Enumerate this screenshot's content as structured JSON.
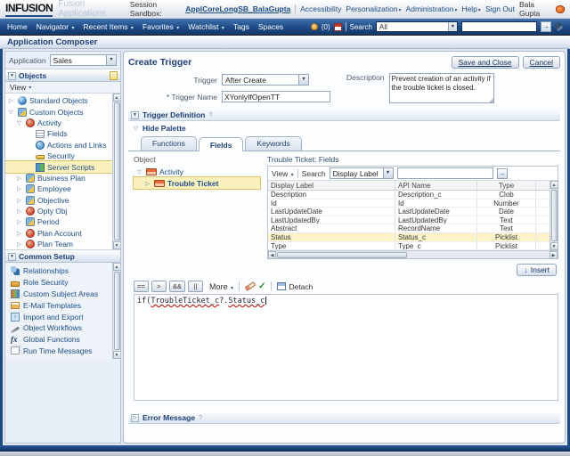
{
  "page_title": "Application Composer",
  "header": {
    "logo": "INFUSION",
    "watermark": "Fusion Applications",
    "session_label": "Session Sandbox:",
    "session_value": "ApplCoreLongSB_BalaGupta",
    "accessibility": "Accessibility",
    "personalization": "Personalization",
    "administration": "Administration",
    "help": "Help",
    "sign_out": "Sign Out",
    "user": "Bala Gupta"
  },
  "navbar": {
    "items": [
      {
        "label": "Home"
      },
      {
        "label": "Navigator"
      },
      {
        "label": "Recent Items"
      },
      {
        "label": "Favorites"
      },
      {
        "label": "Watchlist"
      },
      {
        "label": "Tags"
      },
      {
        "label": "Spaces"
      }
    ],
    "notification_count": "(0)",
    "search_label": "Search",
    "search_scope": "All",
    "search_value": ""
  },
  "sidebar": {
    "application_label": "Application",
    "application_value": "Sales",
    "objects_panel": {
      "title": "Objects",
      "view_menu": "View",
      "tree": [
        {
          "label": "Standard Objects"
        },
        {
          "label": "Custom Objects"
        },
        {
          "label": "Activity"
        },
        {
          "label": "Fields"
        },
        {
          "label": "Actions and Links"
        },
        {
          "label": "Security"
        },
        {
          "label": "Server Scripts"
        },
        {
          "label": "Business Plan"
        },
        {
          "label": "Employee"
        },
        {
          "label": "Objective"
        },
        {
          "label": "Opty Obj"
        },
        {
          "label": "Period"
        },
        {
          "label": "Plan Account"
        },
        {
          "label": "Plan Team"
        }
      ]
    },
    "common_setup": {
      "title": "Common Setup",
      "items": [
        {
          "label": "Relationships"
        },
        {
          "label": "Role Security"
        },
        {
          "label": "Custom Subject Areas"
        },
        {
          "label": "E-Mail Templates"
        },
        {
          "label": "Import and Export"
        },
        {
          "label": "Object Workflows"
        },
        {
          "label": "Global Functions"
        },
        {
          "label": "Run Time Messages"
        }
      ]
    }
  },
  "main": {
    "title": "Create Trigger",
    "save_button": "Save and Close",
    "cancel_button": "Cancel",
    "trigger_label": "Trigger",
    "trigger_value": "After Create",
    "trigger_name_label": "* Trigger Name",
    "trigger_name_value": "XYonlyIfOpenTT",
    "description_label": "Description",
    "description_value": "Prevent creation of an activity if the trouble ticket is closed.",
    "trigger_definition": {
      "title": "Trigger Definition",
      "hide_palette": "Hide Palette",
      "tabs": [
        {
          "label": "Functions"
        },
        {
          "label": "Fields"
        },
        {
          "label": "Keywords"
        }
      ],
      "active_tab": "Fields",
      "object_label": "Object",
      "object_tree": [
        {
          "label": "Activity"
        },
        {
          "label": "Trouble Ticket"
        }
      ],
      "fields_table": {
        "title": "Trouble Ticket: Fields",
        "view_menu": "View",
        "search_label": "Search",
        "search_scope": "Display Label",
        "columns": [
          "Display Label",
          "API Name",
          "Type"
        ],
        "rows": [
          {
            "label": "Description",
            "api": "Description_c",
            "type": "Clob"
          },
          {
            "label": "Id",
            "api": "Id",
            "type": "Number"
          },
          {
            "label": "LastUpdateDate",
            "api": "LastUpdateDate",
            "type": "Date"
          },
          {
            "label": "LastUpdatedBy",
            "api": "LastUpdatedBy",
            "type": "Text"
          },
          {
            "label": "Abstract",
            "api": "RecordName",
            "type": "Text"
          },
          {
            "label": "Status",
            "api": "Status_c",
            "type": "Picklist"
          },
          {
            "label": "Type",
            "api": "Type_c",
            "type": "Picklist"
          }
        ],
        "selected_row": "Status"
      },
      "insert_button": "Insert",
      "editor": {
        "op1": "==",
        "op2": ">",
        "op3": "&&",
        "op4": "||",
        "more_label": "More",
        "detach_label": "Detach",
        "code": {
          "keyword": "if(",
          "ident1": "TroubleTicket_c",
          "operator": "?.",
          "ident2": "Status_c"
        }
      }
    },
    "error_message_title": "Error Message"
  },
  "icons": {
    "dropdown_arrow": "▼",
    "menu_arrow": "▾",
    "tree_collapsed": "▷",
    "tree_expanded": "▽",
    "go_arrow": "→",
    "insert_arrow": "↓",
    "check": "✓",
    "scroll_up": "▲",
    "scroll_down": "▼",
    "scroll_left": "◀",
    "scroll_right": "▶",
    "section_marker": "?"
  },
  "colors": {
    "navbar_blue": "#1d4a86",
    "heading_blue": "#1f3f77",
    "selection_yellow": "#fcf3c8",
    "error_red": "#cc0000"
  }
}
